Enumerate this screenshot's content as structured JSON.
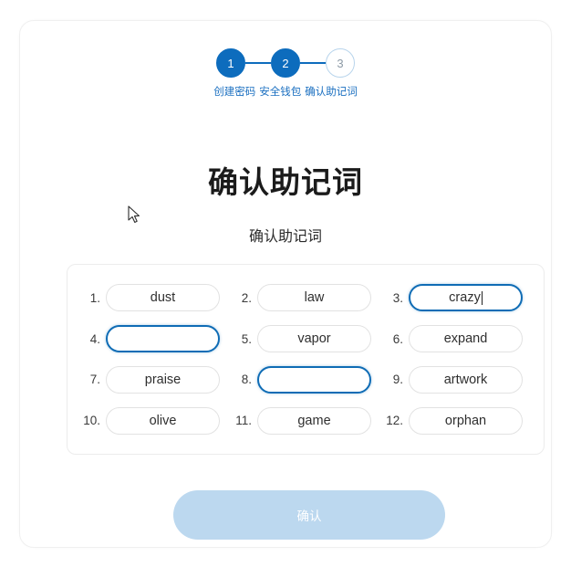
{
  "stepper": {
    "steps": [
      {
        "number": "1",
        "label": "创建密码",
        "state": "done"
      },
      {
        "number": "2",
        "label": "安全钱包",
        "state": "done"
      },
      {
        "number": "3",
        "label": "确认助记词",
        "state": "todo"
      }
    ],
    "active_color": "#0d6cbd",
    "label_color": "#1a6fc0"
  },
  "heading": {
    "title": "确认助记词",
    "subtitle": "确认助记词"
  },
  "mnemonic": {
    "words": [
      {
        "index": "1.",
        "value": "dust",
        "focused": false,
        "caret": false
      },
      {
        "index": "2.",
        "value": "law",
        "focused": false,
        "caret": false
      },
      {
        "index": "3.",
        "value": "crazy",
        "focused": true,
        "caret": true
      },
      {
        "index": "4.",
        "value": "",
        "focused": true,
        "caret": false
      },
      {
        "index": "5.",
        "value": "vapor",
        "focused": false,
        "caret": false
      },
      {
        "index": "6.",
        "value": "expand",
        "focused": false,
        "caret": false
      },
      {
        "index": "7.",
        "value": "praise",
        "focused": false,
        "caret": false
      },
      {
        "index": "8.",
        "value": "",
        "focused": true,
        "caret": false
      },
      {
        "index": "9.",
        "value": "artwork",
        "focused": false,
        "caret": false
      },
      {
        "index": "10.",
        "value": "olive",
        "focused": false,
        "caret": false
      },
      {
        "index": "11.",
        "value": "game",
        "focused": false,
        "caret": false
      },
      {
        "index": "12.",
        "value": "orphan",
        "focused": false,
        "caret": false
      }
    ],
    "focus_border_color": "#0f6cb5",
    "idle_border_color": "#e2e2e2"
  },
  "actions": {
    "confirm_label": "确认",
    "confirm_disabled_color": "#bcd8ef"
  },
  "cursor": {
    "icon": "arrow-pointer-icon"
  }
}
